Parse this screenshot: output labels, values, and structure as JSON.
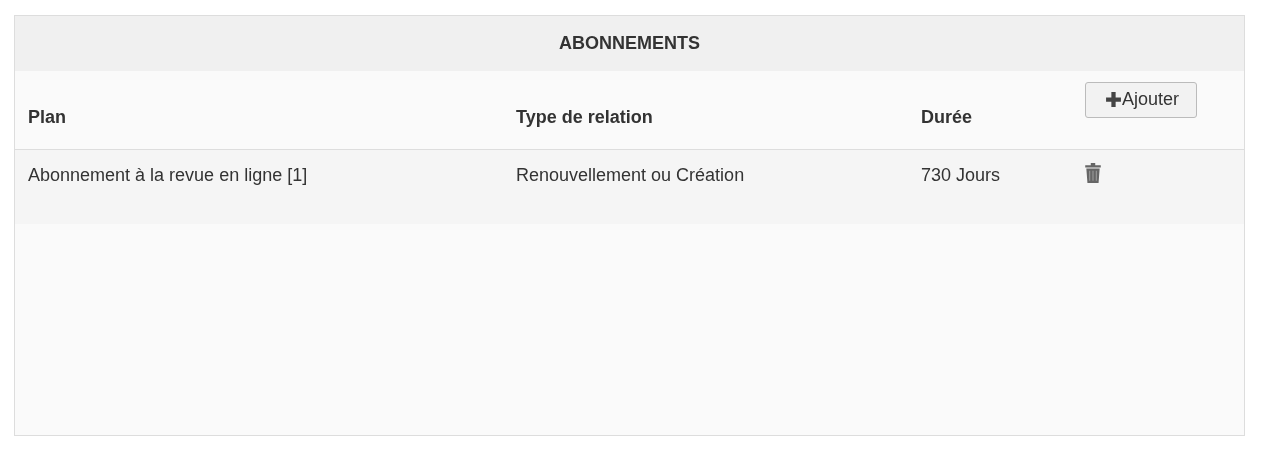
{
  "panel": {
    "title": "ABONNEMENTS"
  },
  "table": {
    "columns": [
      "Plan",
      "Type de relation",
      "Durée"
    ],
    "add_button": {
      "label": "Ajouter"
    },
    "rows": [
      {
        "cells": [
          "Abonnement à la revue en ligne [1]",
          "Renouvellement ou Création",
          "730 Jours"
        ]
      }
    ]
  }
}
